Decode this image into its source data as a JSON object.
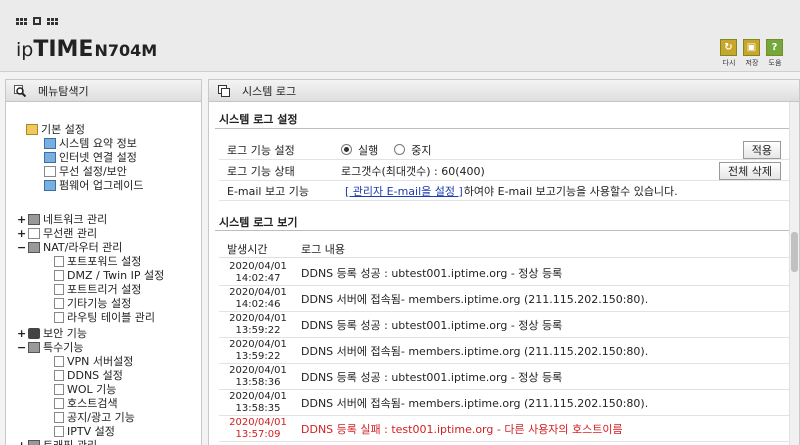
{
  "header": {
    "logo_ip": "ip",
    "logo_time": "TIME",
    "logo_model": "N704M",
    "buttons": [
      {
        "label": "다시",
        "icon": "refresh-icon",
        "color": "#c7a62a"
      },
      {
        "label": "저장",
        "icon": "save-icon",
        "color": "#c7a62a"
      },
      {
        "label": "도움",
        "icon": "help-icon",
        "color": "#74a83a"
      }
    ]
  },
  "sidebar": {
    "title": "메뉴탐색기",
    "items": [
      {
        "label": "기본 설정",
        "level": 0,
        "toggle": "",
        "icon": "folder-icon"
      },
      {
        "label": "시스템 요약 정보",
        "level": 1,
        "toggle": "",
        "icon": "chart-icon"
      },
      {
        "label": "인터넷 연결 설정",
        "level": 1,
        "toggle": "",
        "icon": "pc-icon"
      },
      {
        "label": "무선 설정/보안",
        "level": 1,
        "toggle": "",
        "icon": "wifi-icon"
      },
      {
        "label": "펌웨어 업그레이드",
        "level": 1,
        "toggle": "",
        "icon": "upgrade-icon"
      },
      {
        "label": "네트워크 관리",
        "level": 0,
        "toggle": "+",
        "icon": "network-icon"
      },
      {
        "label": "무선랜 관리",
        "level": 0,
        "toggle": "+",
        "icon": "wifi-icon"
      },
      {
        "label": "NAT/라우터 관리",
        "level": 0,
        "toggle": "−",
        "icon": "router-icon"
      },
      {
        "label": "포트포워드 설정",
        "level": 2,
        "toggle": "",
        "icon": "page-icon"
      },
      {
        "label": "DMZ / Twin IP 설정",
        "level": 2,
        "toggle": "",
        "icon": "page-icon"
      },
      {
        "label": "포트트리거 설정",
        "level": 2,
        "toggle": "",
        "icon": "page-icon"
      },
      {
        "label": "기타기능 설정",
        "level": 2,
        "toggle": "",
        "icon": "page-icon"
      },
      {
        "label": "라우팅 테이블 관리",
        "level": 2,
        "toggle": "",
        "icon": "page-icon"
      },
      {
        "label": "보안 기능",
        "level": 0,
        "toggle": "+",
        "icon": "lock-icon"
      },
      {
        "label": "특수기능",
        "level": 0,
        "toggle": "−",
        "icon": "special-icon"
      },
      {
        "label": "VPN 서버설정",
        "level": 2,
        "toggle": "",
        "icon": "page-icon"
      },
      {
        "label": "DDNS 설정",
        "level": 2,
        "toggle": "",
        "icon": "page-icon"
      },
      {
        "label": "WOL 기능",
        "level": 2,
        "toggle": "",
        "icon": "page-icon"
      },
      {
        "label": "호스트검색",
        "level": 2,
        "toggle": "",
        "icon": "page-icon"
      },
      {
        "label": "공지/광고 기능",
        "level": 2,
        "toggle": "",
        "icon": "page-icon"
      },
      {
        "label": "IPTV 설정",
        "level": 2,
        "toggle": "",
        "icon": "page-icon"
      },
      {
        "label": "트래픽 관리",
        "level": 0,
        "toggle": "+",
        "icon": "traffic-icon"
      }
    ]
  },
  "main": {
    "title": "시스템 로그",
    "settings": {
      "title": "시스템 로그 설정",
      "rows": {
        "log_function_label": "로그 기능 설정",
        "radio_on": "실행",
        "radio_off": "중지",
        "apply_button": "적용",
        "log_status_label": "로그 기능 상태",
        "log_status_value": "로그갯수(최대갯수) : 60(400)",
        "delete_all_button": "전체 삭제",
        "email_label": "E-mail 보고 기능",
        "email_link": "[ 관리자 E-mail을 설정 ]",
        "email_text": "하여야 E-mail 보고기능을 사용할수 있습니다."
      }
    },
    "log_view": {
      "title": "시스템 로그 보기",
      "col_time": "발생시간",
      "col_content": "로그 내용",
      "rows": [
        {
          "date": "2020/04/01",
          "time": "14:02:47",
          "message": "DDNS 등록 성공 : ubtest001.iptime.org - 정상 등록",
          "error": false
        },
        {
          "date": "2020/04/01",
          "time": "14:02:46",
          "message": "DDNS 서버에 접속됨- members.iptime.org (211.115.202.150:80).",
          "error": false
        },
        {
          "date": "2020/04/01",
          "time": "13:59:22",
          "message": "DDNS 등록 성공 : ubtest001.iptime.org - 정상 등록",
          "error": false
        },
        {
          "date": "2020/04/01",
          "time": "13:59:22",
          "message": "DDNS 서버에 접속됨- members.iptime.org (211.115.202.150:80).",
          "error": false
        },
        {
          "date": "2020/04/01",
          "time": "13:58:36",
          "message": "DDNS 등록 성공 : ubtest001.iptime.org - 정상 등록",
          "error": false
        },
        {
          "date": "2020/04/01",
          "time": "13:58:35",
          "message": "DDNS 서버에 접속됨- members.iptime.org (211.115.202.150:80).",
          "error": false
        },
        {
          "date": "2020/04/01",
          "time": "13:57:09",
          "message": "DDNS 등록 실패 : test001.iptime.org - 다른 사용자의 호스트이름",
          "error": true
        }
      ]
    }
  }
}
